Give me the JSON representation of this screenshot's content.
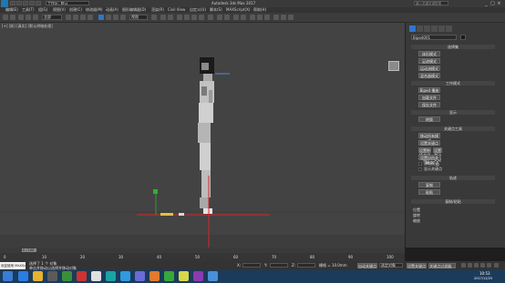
{
  "app": {
    "title": "Autodesk 3ds Max 2017",
    "file_dropdown": "工作区: 默认",
    "search_placeholder": "键入关键字或短语"
  },
  "window_controls": [
    "_",
    "□",
    "×"
  ],
  "menubar": [
    "编辑(E)",
    "工具(T)",
    "组(G)",
    "视图(V)",
    "创建(C)",
    "修改器(M)",
    "动画(A)",
    "图形编辑器(D)",
    "渲染(R)",
    "Civil View",
    "自定义(U)",
    "脚本(S)",
    "MAXScript(X)",
    "帮助(H)"
  ],
  "toolbar": {
    "selection_filter": "全部",
    "view_dropdown": "视图"
  },
  "viewport": {
    "label": "[+] [前] [真实] [默认明暗处理]"
  },
  "command_panel": {
    "rollouts": {
      "selection_sets": "选择集",
      "work_modes": "工作模式",
      "display": "显示",
      "keyframe_tools": "关键点工具",
      "copy_paste": "复制/粘贴"
    },
    "buttons": {
      "name_display": "Biped001",
      "figure_mode": "体形模式",
      "footstep_mode": "足迹模式",
      "motion_flow": "运动流模式",
      "mixer_mode": "混合器模式",
      "biped_playback": "Biped 播放",
      "load": "加载文件",
      "save": "保存文件",
      "convert": "转换",
      "move_all": "移动所有模式",
      "create_key": "设置关键点",
      "set_planted": "设置种植关键点",
      "set_sliding": "设置滑动关键点",
      "set_free": "设置自由关键点",
      "trajectory": "轨迹",
      "copy": "复制",
      "paste": "粘贴"
    },
    "options": {
      "in_place": "原地模式",
      "show_key": "显示关键点",
      "opt_a": "位置",
      "opt_b": "旋转",
      "opt_c": "缩放"
    }
  },
  "timeline": {
    "frame_counter": "0 / 100",
    "ticks": [
      "0",
      "10",
      "20",
      "30",
      "40",
      "50",
      "60",
      "70",
      "80",
      "90",
      "100"
    ]
  },
  "statusbar": {
    "script_label": "欢迎使用 MAXSc",
    "status_line1": "选择了 1 个 对象",
    "status_line2": "单击并拖动以选择并移动对象",
    "x_label": "X:",
    "y_label": "Y:",
    "z_label": "Z:",
    "grid": "栅格 = 10.0mm",
    "autokey": "自动关键点",
    "selected": "选定对象",
    "setkey": "设置关键点",
    "keyfilter": "关键点过滤器..."
  },
  "taskbar": {
    "time": "10:53",
    "date": "2017/12/25"
  },
  "colors": {
    "viewport_bg": "#434343",
    "panel_bg": "#393939",
    "axis_red": "#d9252a",
    "axis_green": "#2ab52a",
    "accent_blue": "#2f77c9",
    "taskbar_bg": "#1b3b5a"
  }
}
